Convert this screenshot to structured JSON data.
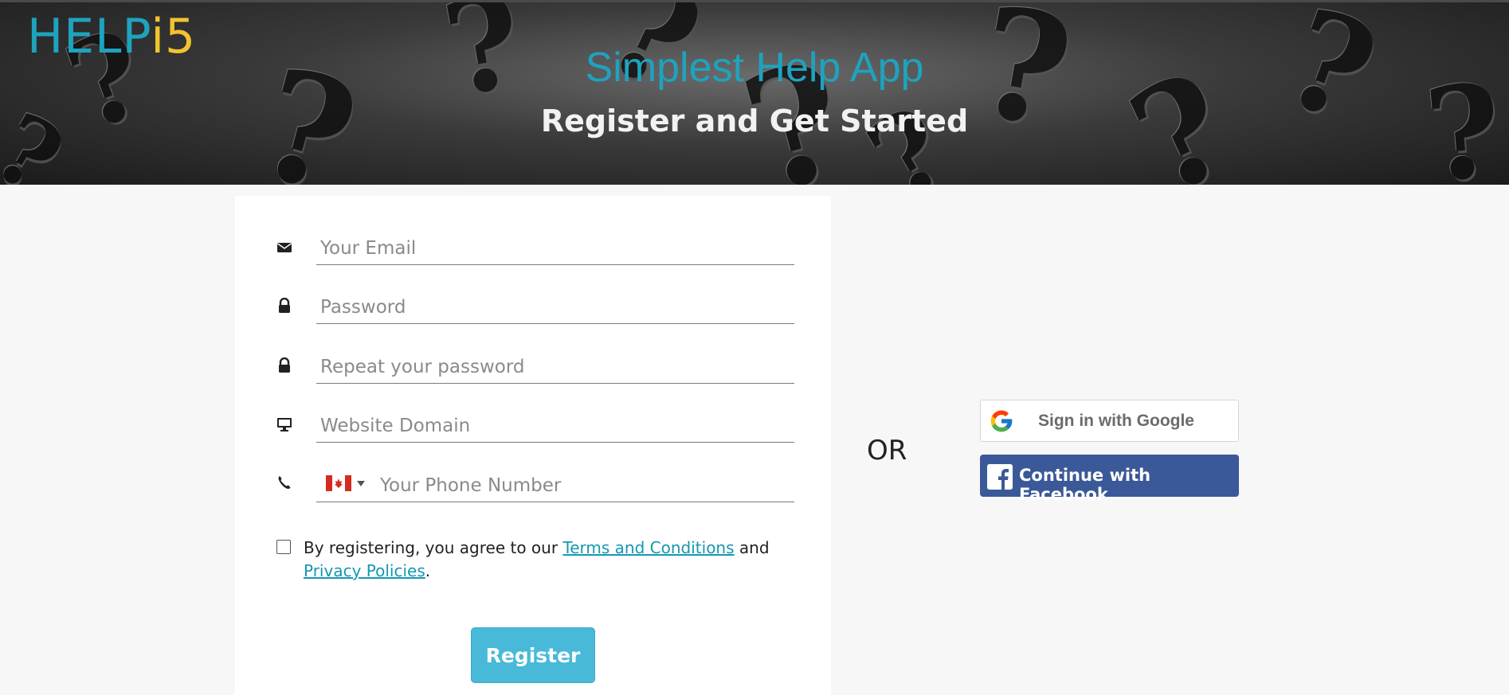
{
  "header": {
    "logo_part1": "HELP",
    "logo_part2": "i5",
    "title": "Simplest Help App",
    "subtitle": "Register and Get Started"
  },
  "form": {
    "email_placeholder": "Your Email",
    "password_placeholder": "Password",
    "repeat_password_placeholder": "Repeat your password",
    "domain_placeholder": "Website Domain",
    "phone_placeholder": "Your Phone Number",
    "phone_country": "CA",
    "terms_prefix": "By registering, you agree to our ",
    "terms_link": "Terms and Conditions",
    "terms_middle": " and",
    "privacy_link": "Privacy Policies",
    "terms_suffix": ".",
    "register_label": "Register"
  },
  "social": {
    "or_label": "OR",
    "google_label": "Sign in with Google",
    "facebook_label": "Continue with Facebook"
  },
  "colors": {
    "accent": "#1ea3bf",
    "logo_yellow": "#f2c230",
    "register_button": "#48b9d8",
    "facebook_blue": "#3b5998"
  },
  "icons": [
    "envelope-icon",
    "lock-icon",
    "lock-icon",
    "monitor-icon",
    "phone-icon",
    "canada-flag-icon",
    "google-icon",
    "facebook-icon"
  ]
}
